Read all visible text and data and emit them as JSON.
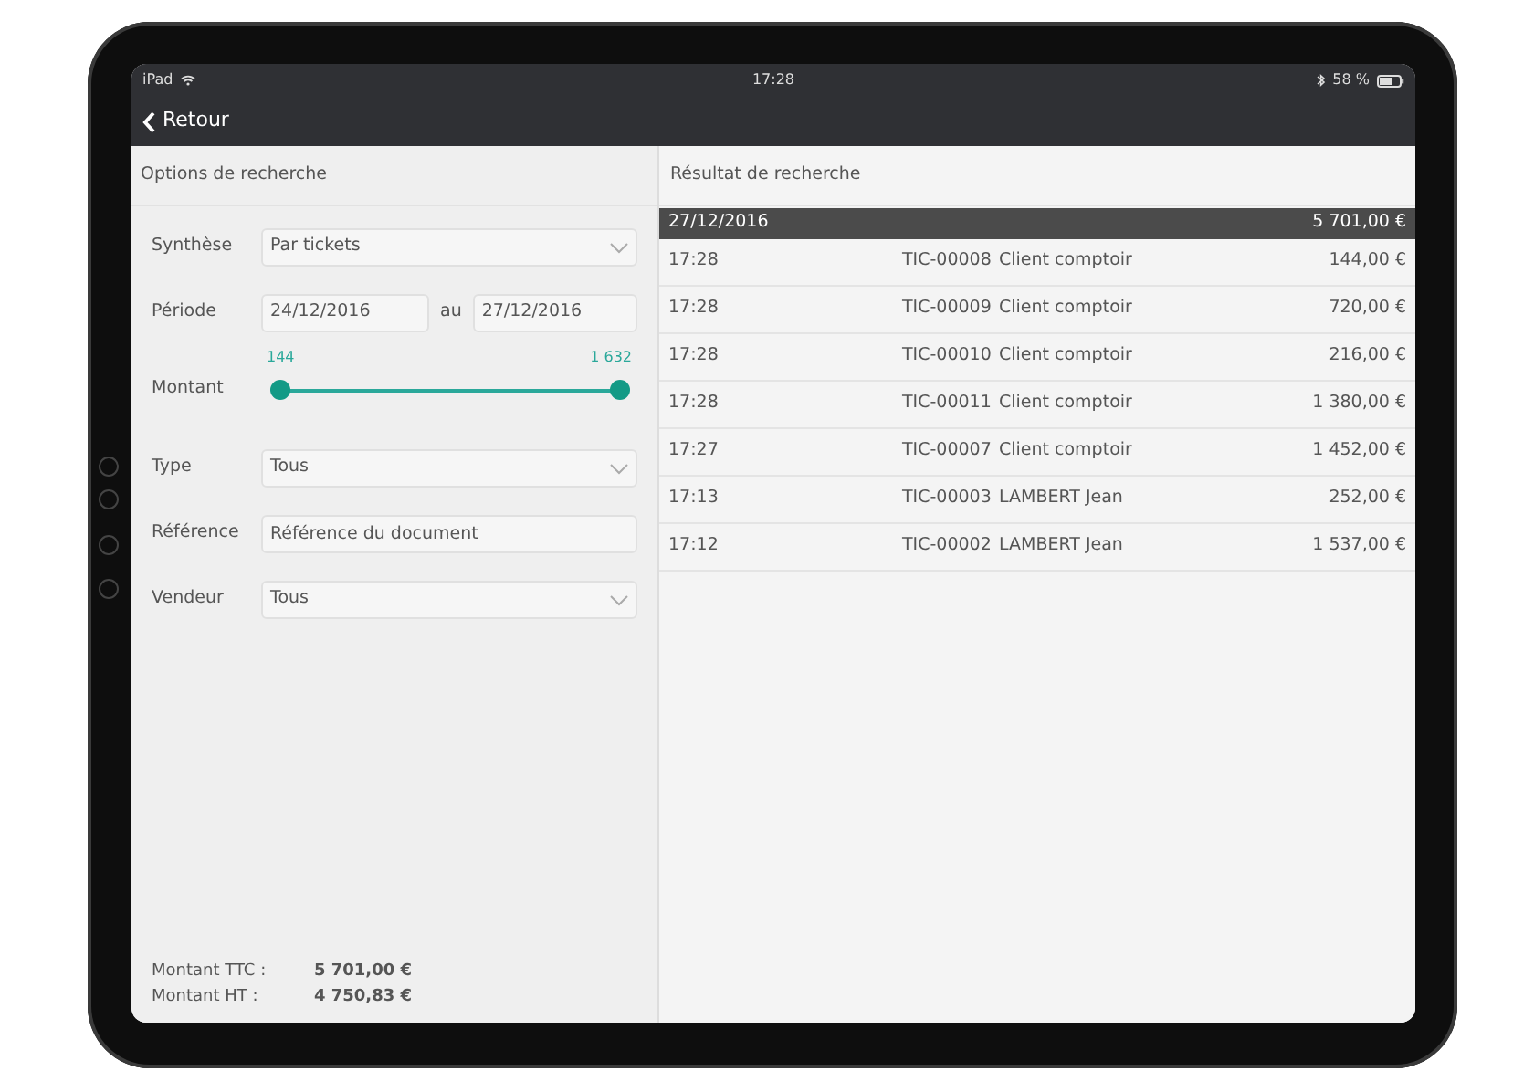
{
  "status_bar": {
    "device": "iPad",
    "time": "17:28",
    "battery": "58 %"
  },
  "nav": {
    "back": "Retour"
  },
  "options": {
    "title": "Options de recherche",
    "fields": [
      {
        "kind": "select",
        "label": "Synthèse",
        "value": "Par tickets"
      },
      {
        "kind": "daterange",
        "label": "Période",
        "from": "24/12/2016",
        "separator": "au",
        "to": "27/12/2016"
      },
      {
        "kind": "range",
        "label": "Montant",
        "min_label": "144",
        "max_label": "1 632",
        "low_thumb": {
          "level": 0
        },
        "high_thumb": {
          "level": 1
        }
      },
      {
        "kind": "select",
        "label": "Type",
        "value": "Tous"
      },
      {
        "kind": "text",
        "label": "Référence",
        "placeholder": "Référence du document"
      },
      {
        "kind": "select",
        "label": "Vendeur",
        "value": "Tous"
      }
    ],
    "totals": [
      {
        "label": "Montant TTC :",
        "value": "5 701,00 €"
      },
      {
        "label": "Montant HT :",
        "value": "4 750,83 €"
      }
    ]
  },
  "results": {
    "title": "Résultat de recherche",
    "group": {
      "date": "27/12/2016",
      "total": "5 701,00 €"
    },
    "rows": [
      {
        "time": "17:28",
        "ticket": "TIC-00008",
        "client": "Client comptoir",
        "amount": "144,00 €"
      },
      {
        "time": "17:28",
        "ticket": "TIC-00009",
        "client": "Client comptoir",
        "amount": "720,00 €"
      },
      {
        "time": "17:28",
        "ticket": "TIC-00010",
        "client": "Client comptoir",
        "amount": "216,00 €"
      },
      {
        "time": "17:28",
        "ticket": "TIC-00011",
        "client": "Client comptoir",
        "amount": "1 380,00 €"
      },
      {
        "time": "17:27",
        "ticket": "TIC-00007",
        "client": "Client comptoir",
        "amount": "1 452,00 €"
      },
      {
        "time": "17:13",
        "ticket": "TIC-00003",
        "client": "LAMBERT Jean",
        "amount": "252,00 €"
      },
      {
        "time": "17:12",
        "ticket": "TIC-00002",
        "client": "LAMBERT Jean",
        "amount": "1 537,00 €"
      }
    ]
  }
}
